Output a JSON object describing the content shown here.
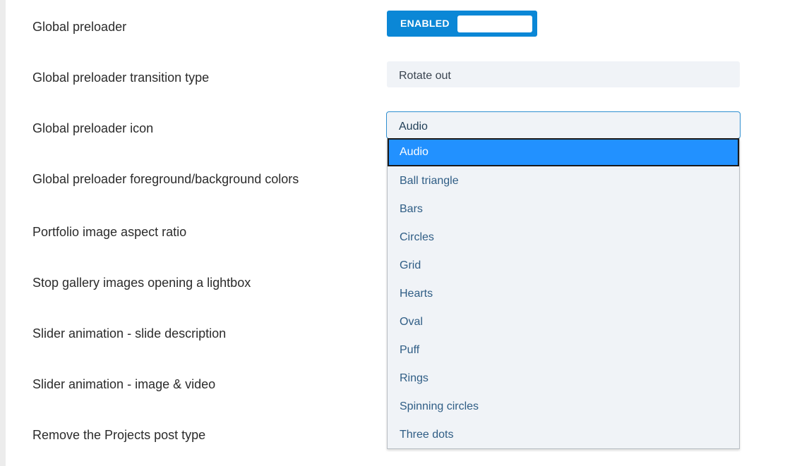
{
  "settings": [
    {
      "label": "Global preloader"
    },
    {
      "label": "Global preloader transition type"
    },
    {
      "label": "Global preloader icon"
    },
    {
      "label": "Global preloader foreground/background colors"
    },
    {
      "label": "Portfolio image aspect ratio"
    },
    {
      "label": "Stop gallery images opening a lightbox"
    },
    {
      "label": "Slider animation - slide description"
    },
    {
      "label": "Slider animation - image & video"
    },
    {
      "label": "Remove the Projects post type"
    }
  ],
  "preloader_toggle": {
    "state_label": "ENABLED",
    "accent": "#0b87d6"
  },
  "transition_select": {
    "value": "Rotate out"
  },
  "icon_select": {
    "value": "Audio",
    "options": [
      "Audio",
      "Ball triangle",
      "Bars",
      "Circles",
      "Grid",
      "Hearts",
      "Oval",
      "Puff",
      "Rings",
      "Spinning circles",
      "Three dots"
    ],
    "highlight_color": "#2291ff"
  }
}
